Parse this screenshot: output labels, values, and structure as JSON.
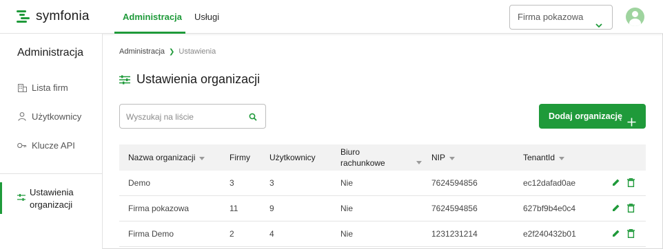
{
  "app": {
    "logo_text": "symfonia"
  },
  "topnav": {
    "tabs": [
      {
        "label": "Administracja",
        "active": true
      },
      {
        "label": "Usługi",
        "active": false
      }
    ],
    "company_select": "Firma pokazowa"
  },
  "sidebar": {
    "title": "Administracja",
    "items": [
      {
        "label": "Lista firm",
        "icon": "building-icon"
      },
      {
        "label": "Użytkownicy",
        "icon": "user-icon"
      },
      {
        "label": "Klucze API",
        "icon": "key-icon"
      }
    ],
    "active_item": {
      "label_line1": "Ustawienia",
      "label_line2": "organizacji",
      "icon": "sliders-icon"
    }
  },
  "breadcrumb": {
    "root": "Administracja",
    "current": "Ustawienia"
  },
  "page": {
    "title": "Ustawienia organizacji"
  },
  "search": {
    "placeholder": "Wyszukaj na liście"
  },
  "add_button": {
    "label": "Dodaj organizację"
  },
  "table": {
    "columns": [
      {
        "label": "Nazwa organizacji",
        "sortable": true
      },
      {
        "label": "Firmy",
        "sortable": false
      },
      {
        "label": "Użytkownicy",
        "sortable": false
      },
      {
        "label_line1": "Biuro",
        "label_line2": "rachunkowe",
        "sortable": true
      },
      {
        "label": "NIP",
        "sortable": true
      },
      {
        "label": "TenantId",
        "sortable": true
      }
    ],
    "rows": [
      {
        "name": "Demo",
        "firms": "3",
        "users": "3",
        "office": "Nie",
        "nip": "7624594856",
        "tenant": "ec12dafad0ae"
      },
      {
        "name": "Firma pokazowa",
        "firms": "11",
        "users": "9",
        "office": "Nie",
        "nip": "7624594856",
        "tenant": "627bf9b4e0c4"
      },
      {
        "name": "Firma Demo",
        "firms": "2",
        "users": "4",
        "office": "Nie",
        "nip": "1231231214",
        "tenant": "e2f240432b01"
      }
    ]
  },
  "colors": {
    "accent": "#1f9a3a",
    "header_bg": "#f2f2f2",
    "avatar_bg": "#9fd49f"
  }
}
